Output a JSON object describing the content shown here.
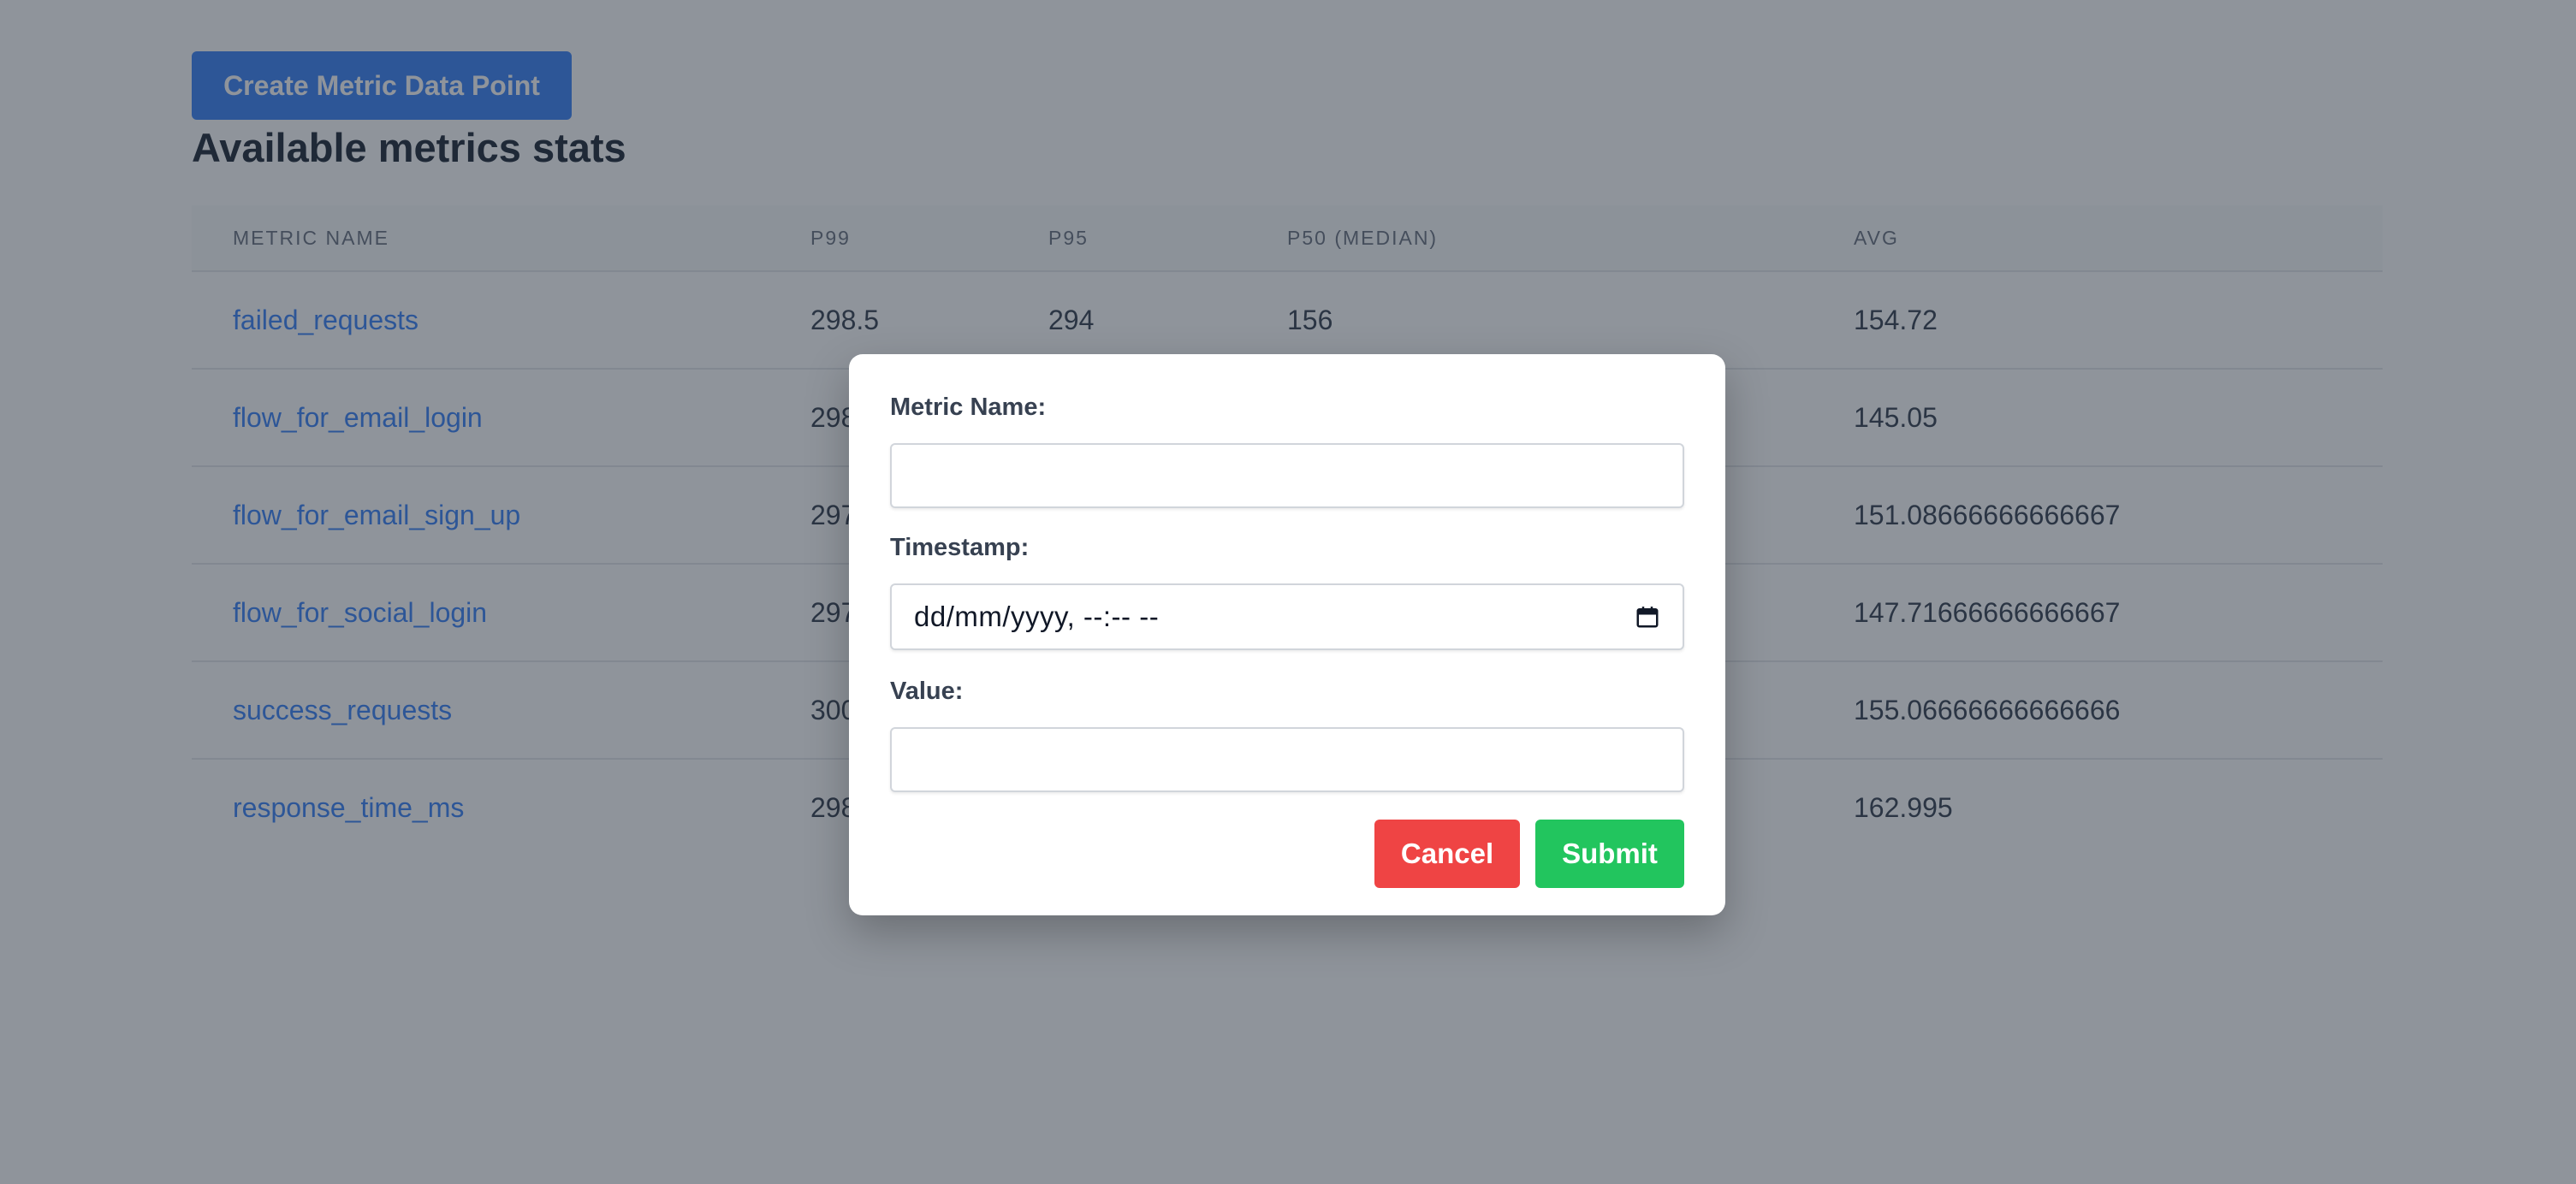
{
  "toolbar": {
    "create_label": "Create Metric Data Point"
  },
  "page": {
    "title": "Available metrics stats"
  },
  "table": {
    "headers": [
      "METRIC NAME",
      "P99",
      "P95",
      "P50 (MEDIAN)",
      "AVG"
    ],
    "rows": [
      {
        "name": "failed_requests",
        "p99": "298.5",
        "p95": "294",
        "p50": "156",
        "avg": "154.72"
      },
      {
        "name": "flow_for_email_login",
        "p99": "298",
        "p95": "",
        "p50": "",
        "avg": "145.05"
      },
      {
        "name": "flow_for_email_sign_up",
        "p99": "297",
        "p95": "",
        "p50": "",
        "avg": "151.08666666666667"
      },
      {
        "name": "flow_for_social_login",
        "p99": "297",
        "p95": "",
        "p50": "",
        "avg": "147.71666666666667"
      },
      {
        "name": "success_requests",
        "p99": "300",
        "p95": "",
        "p50": "",
        "avg": "155.06666666666666"
      },
      {
        "name": "response_time_ms",
        "p99": "298",
        "p95": "",
        "p50": "",
        "avg": "162.995"
      }
    ]
  },
  "modal": {
    "metric_name_label": "Metric Name:",
    "metric_name_value": "",
    "timestamp_label": "Timestamp:",
    "timestamp_placeholder": "dd/mm/yyyy, --:-- --",
    "value_label": "Value:",
    "value_value": "",
    "cancel_label": "Cancel",
    "submit_label": "Submit"
  },
  "icons": {
    "calendar": "calendar-icon"
  },
  "colors": {
    "primary": "#3b82f6",
    "danger": "#ef4444",
    "success": "#22c55e",
    "overlay": "rgba(31,41,55,0.5)"
  }
}
